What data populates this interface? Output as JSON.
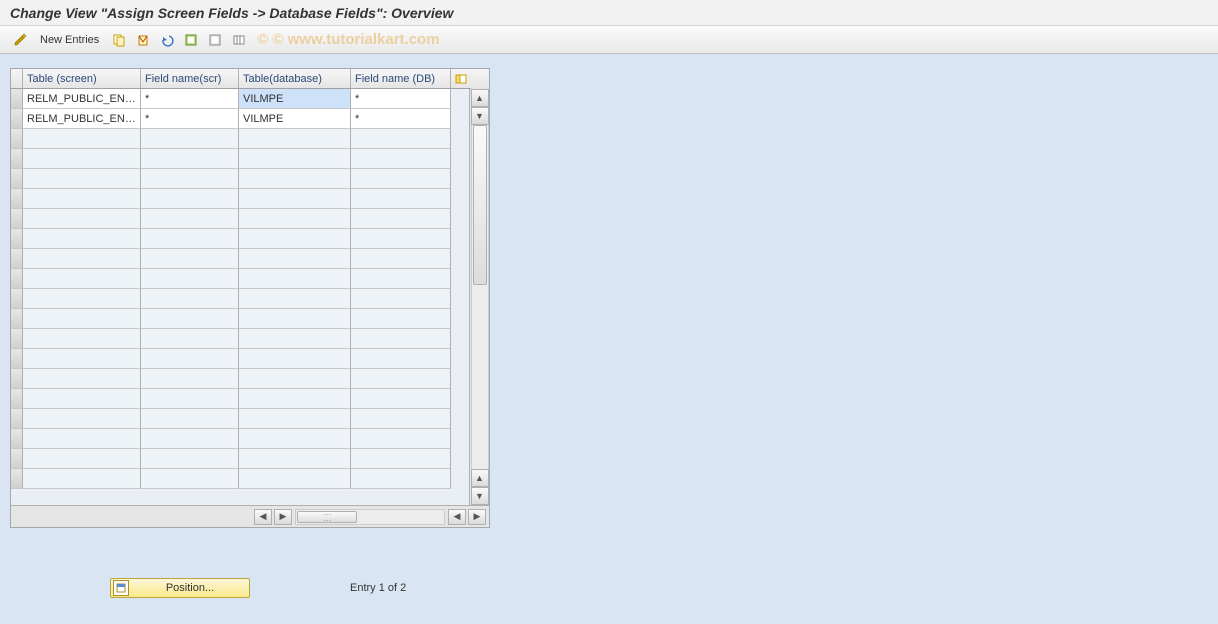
{
  "title": "Change View \"Assign Screen Fields -> Database Fields\": Overview",
  "toolbar": {
    "new_entries": "New Entries"
  },
  "watermark": "© www.tutorialkart.com",
  "table": {
    "headers": {
      "col1": "Table (screen)",
      "col2": "Field name(scr)",
      "col3": "Table(database)",
      "col4": "Field name (DB)"
    },
    "rows": [
      {
        "table_screen": "RELM_PUBLIC_EN…",
        "field_scr": "*",
        "table_db": "VILMPE",
        "field_db": "*",
        "db_selected": true
      },
      {
        "table_screen": "RELM_PUBLIC_EN…",
        "field_scr": "*",
        "table_db": "VILMPE",
        "field_db": "*",
        "db_selected": false
      }
    ],
    "empty_rows": 18
  },
  "footer": {
    "position_label": "Position...",
    "entry_info": "Entry 1 of 2"
  }
}
